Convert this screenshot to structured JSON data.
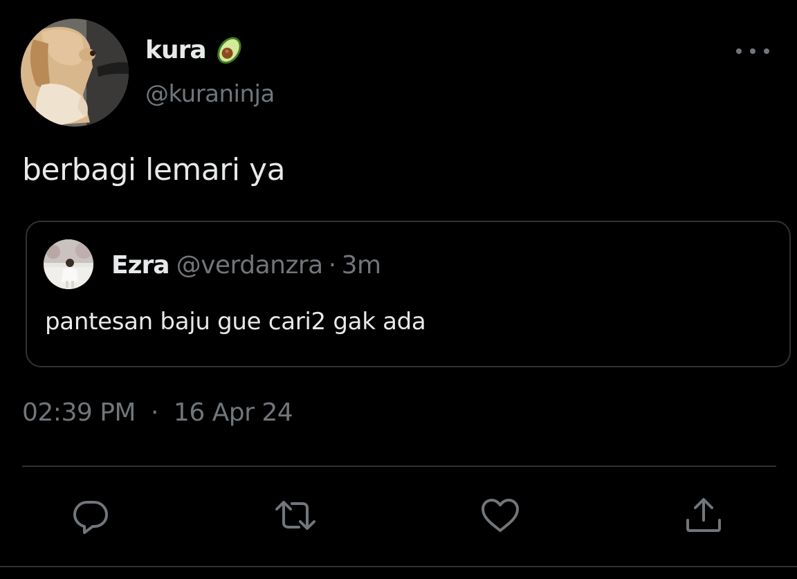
{
  "author": {
    "display_name": "kura",
    "badge_icon": "avocado-emoji",
    "handle": "@kuraninja"
  },
  "tweet": {
    "text": "berbagi lemari ya",
    "time": "02:39 PM",
    "separator": "·",
    "date": "16 Apr 24"
  },
  "quoted_tweet": {
    "display_name": "Ezra",
    "handle": "@verdanzra",
    "separator": "·",
    "relative_time": "3m",
    "text": "pantesan baju gue cari2 gak ada"
  },
  "actions": [
    {
      "icon": "reply-icon"
    },
    {
      "icon": "retweet-icon"
    },
    {
      "icon": "like-icon"
    },
    {
      "icon": "share-icon"
    }
  ],
  "colors": {
    "background": "#000000",
    "primary_text": "#e7e9ea",
    "secondary_text": "#71767b",
    "border": "#2f3336"
  }
}
